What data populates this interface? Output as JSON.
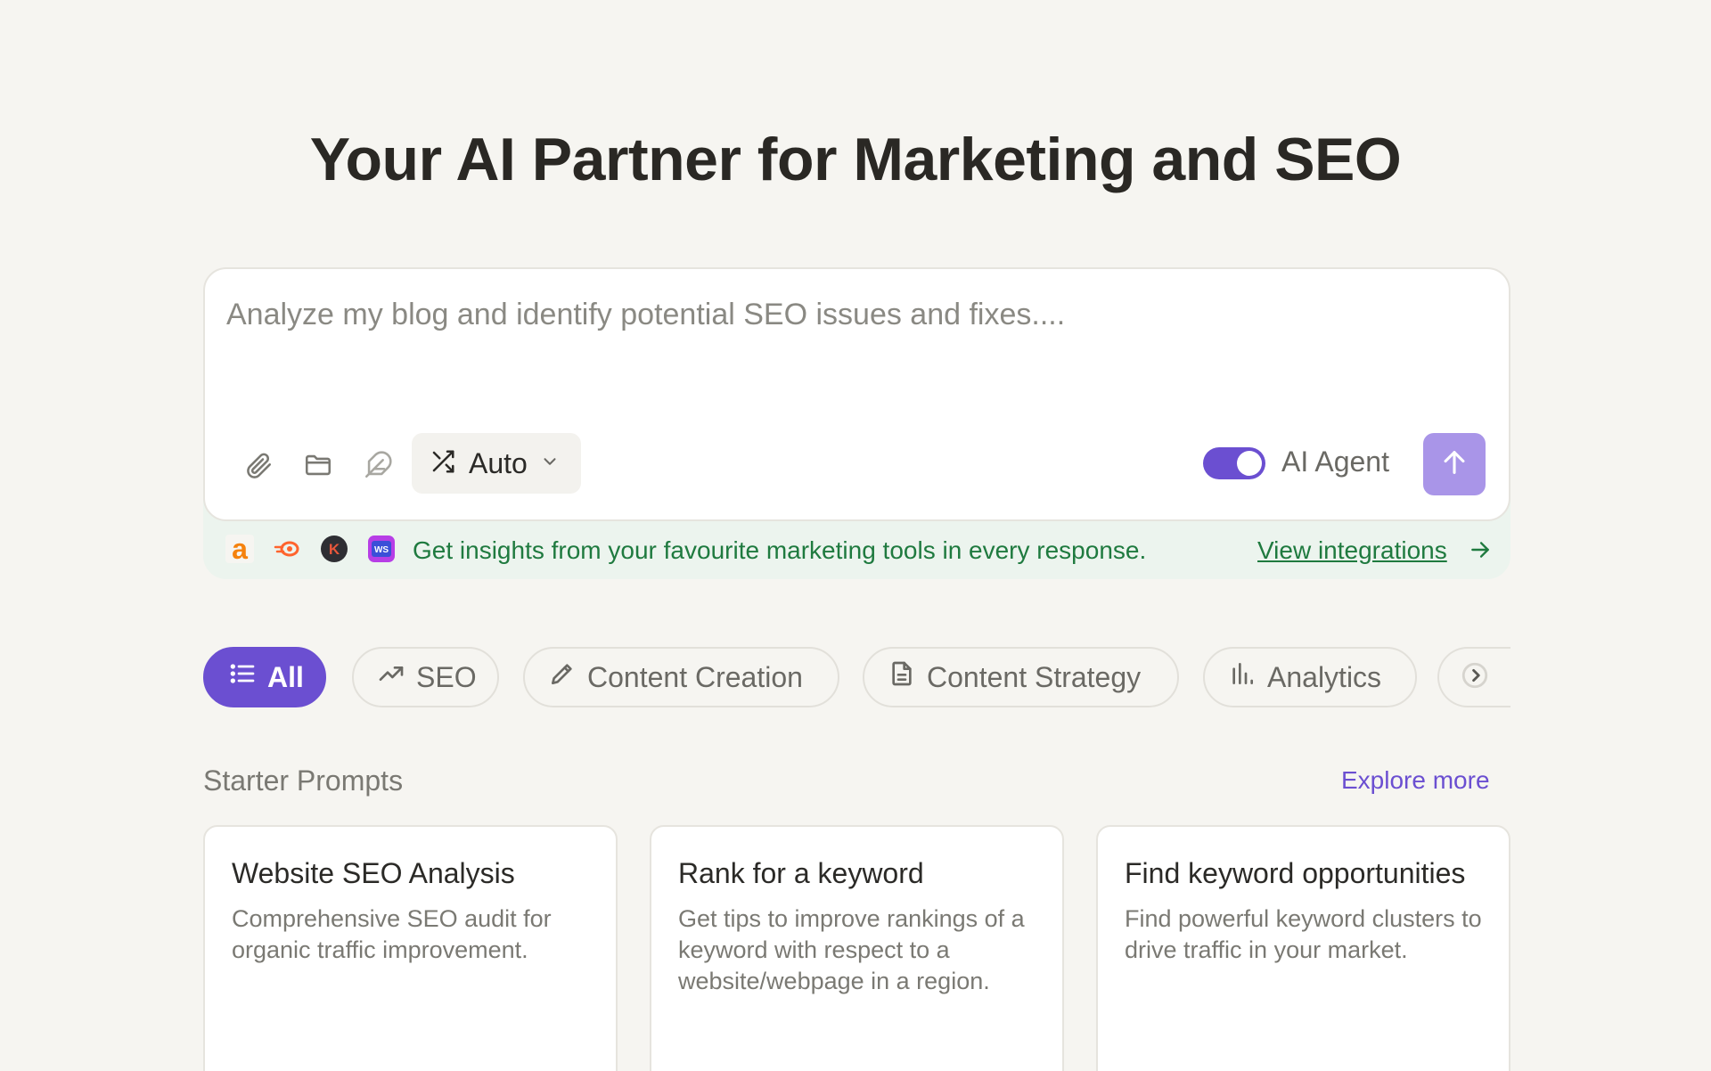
{
  "hero": {
    "title": "Your AI Partner for Marketing and SEO"
  },
  "composer": {
    "placeholder": "Analyze my blog and identify potential SEO issues and fixes....",
    "mode_label": "Auto",
    "agent_label": "AI Agent",
    "agent_enabled": true,
    "accent_color": "#6b4fd1",
    "send_color": "#a995e8"
  },
  "integrations": {
    "text": "Get insights from your favourite marketing tools in every response.",
    "link_label": "View integrations",
    "icons": [
      "ahrefs-logo-icon",
      "semrush-logo-icon",
      "k-logo-icon",
      "wordstream-logo-icon"
    ]
  },
  "chips": [
    {
      "label": "All",
      "icon": "list-icon",
      "active": true
    },
    {
      "label": "SEO",
      "icon": "trending-up-icon",
      "active": false
    },
    {
      "label": "Content Creation",
      "icon": "pencil-icon",
      "active": false
    },
    {
      "label": "Content Strategy",
      "icon": "document-icon",
      "active": false
    },
    {
      "label": "Analytics",
      "icon": "bar-chart-icon",
      "active": false
    }
  ],
  "starter": {
    "title": "Starter Prompts",
    "explore_label": "Explore more",
    "cards": [
      {
        "title": "Website SEO Analysis",
        "desc": "Comprehensive SEO audit for organic traffic improvement."
      },
      {
        "title": "Rank for a keyword",
        "desc": "Get tips to improve rankings of a keyword with respect to a website/webpage in a region."
      },
      {
        "title": "Find keyword opportunities",
        "desc": "Find powerful keyword clusters to drive traffic in your market."
      }
    ]
  }
}
